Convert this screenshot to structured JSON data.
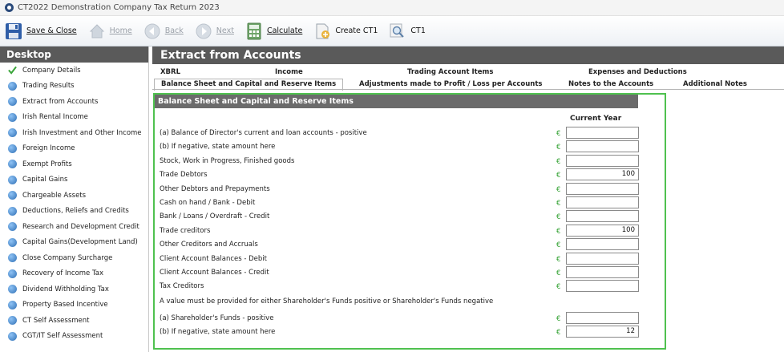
{
  "window": {
    "title": "CT2022 Demonstration Company Tax Return 2023"
  },
  "toolbar": {
    "save_close": "Save & Close",
    "home": "Home",
    "back": "Back",
    "next": "Next",
    "calculate": "Calculate",
    "create_ct1": "Create CT1",
    "ct1": "CT1"
  },
  "sidebar": {
    "header": "Desktop",
    "items": [
      {
        "label": "Company Details",
        "icon": "check-icon"
      },
      {
        "label": "Trading Results",
        "icon": "info-bubble-icon"
      },
      {
        "label": "Extract from Accounts",
        "icon": "info-bubble-icon"
      },
      {
        "label": "Irish Rental Income",
        "icon": "info-bubble-icon"
      },
      {
        "label": "Irish Investment and Other Income",
        "icon": "info-bubble-icon"
      },
      {
        "label": "Foreign Income",
        "icon": "info-bubble-icon"
      },
      {
        "label": "Exempt Profits",
        "icon": "info-bubble-icon"
      },
      {
        "label": "Capital Gains",
        "icon": "info-bubble-icon"
      },
      {
        "label": "Chargeable Assets",
        "icon": "info-bubble-icon"
      },
      {
        "label": "Deductions, Reliefs and Credits",
        "icon": "info-bubble-icon"
      },
      {
        "label": "Research and Development Credit",
        "icon": "info-bubble-icon"
      },
      {
        "label": "Capital Gains(Development Land)",
        "icon": "info-bubble-icon"
      },
      {
        "label": "Close Company Surcharge",
        "icon": "info-bubble-icon"
      },
      {
        "label": "Recovery of Income Tax",
        "icon": "info-bubble-icon"
      },
      {
        "label": "Dividend Withholding Tax",
        "icon": "info-bubble-icon"
      },
      {
        "label": "Property Based Incentive",
        "icon": "info-bubble-icon"
      },
      {
        "label": "CT Self Assessment",
        "icon": "info-bubble-icon"
      },
      {
        "label": "CGT/IT Self Assessment",
        "icon": "info-bubble-icon"
      }
    ]
  },
  "main": {
    "title": "Extract from Accounts",
    "tabs_row1": [
      "XBRL",
      "Income",
      "Trading Account Items",
      "Expenses and Deductions"
    ],
    "tabs_row2": [
      "Balance Sheet and Capital and Reserve Items",
      "Adjustments made to Profit / Loss per Accounts",
      "Notes to the Accounts",
      "Additional Notes"
    ],
    "panel": {
      "header": "Balance Sheet and Capital and Reserve Items",
      "column_header": "Current Year",
      "currency": "€",
      "rows": [
        {
          "label": "(a) Balance of Director's current and loan accounts - positive",
          "value": ""
        },
        {
          "label": "(b) If negative, state amount here",
          "value": ""
        },
        {
          "label": "Stock, Work in Progress, Finished goods",
          "value": ""
        },
        {
          "label": "Trade Debtors",
          "value": "100"
        },
        {
          "label": "Other Debtors and Prepayments",
          "value": ""
        },
        {
          "label": "Cash on hand / Bank - Debit",
          "value": ""
        },
        {
          "label": "Bank / Loans / Overdraft - Credit",
          "value": ""
        },
        {
          "label": "Trade creditors",
          "value": "100"
        },
        {
          "label": "Other Creditors and Accruals",
          "value": ""
        },
        {
          "label": "Client Account Balances - Debit",
          "value": ""
        },
        {
          "label": "Client Account Balances - Credit",
          "value": ""
        },
        {
          "label": "Tax Creditors",
          "value": ""
        }
      ],
      "note": "A value must be provided for either Shareholder's Funds positive or Shareholder's Funds negative",
      "shareholder_rows": [
        {
          "label": "(a) Shareholder's Funds - positive",
          "value": ""
        },
        {
          "label": "(b) If negative, state amount here",
          "value": "12"
        }
      ]
    }
  },
  "colors": {
    "accent_green": "#4fc14f",
    "header_gray": "#5a5a5a",
    "panel_header_gray": "#6b6b6b"
  }
}
